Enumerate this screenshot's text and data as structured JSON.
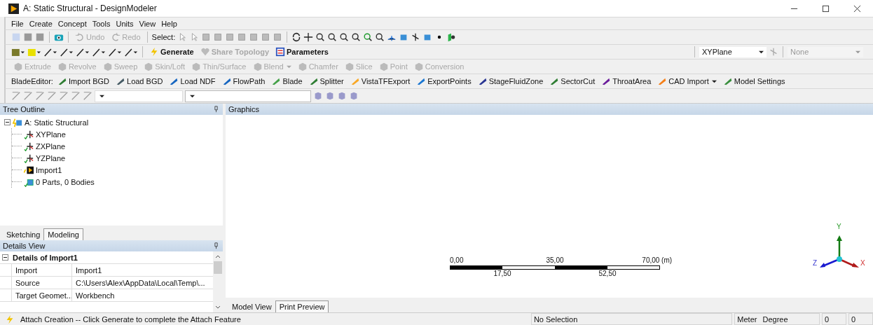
{
  "window": {
    "title": "A: Static Structural - DesignModeler"
  },
  "menu": [
    "File",
    "Create",
    "Concept",
    "Tools",
    "Units",
    "View",
    "Help"
  ],
  "toolbar_main": {
    "undo": {
      "label": "Undo",
      "disabled": true
    },
    "redo": {
      "label": "Redo",
      "disabled": true
    },
    "select_label": "Select:"
  },
  "toolbar_features": {
    "buttons": [
      {
        "label": "Generate",
        "disabled": false,
        "kind": "generate"
      },
      {
        "label": "Share Topology",
        "disabled": true,
        "kind": "share"
      },
      {
        "label": "Parameters",
        "disabled": false,
        "kind": "parameters"
      }
    ],
    "plane": {
      "value": "XYPlane"
    },
    "sketch": {
      "value": "None",
      "disabled": true
    }
  },
  "toolbar_modeling": [
    {
      "label": "Extrude",
      "disabled": true,
      "dropdown": false
    },
    {
      "label": "Revolve",
      "disabled": true,
      "dropdown": false
    },
    {
      "label": "Sweep",
      "disabled": true,
      "dropdown": false
    },
    {
      "label": "Skin/Loft",
      "disabled": true,
      "dropdown": false
    },
    {
      "label": "Thin/Surface",
      "disabled": true,
      "dropdown": false
    },
    {
      "label": "Blend",
      "disabled": true,
      "dropdown": true
    },
    {
      "label": "Chamfer",
      "disabled": true,
      "dropdown": false
    },
    {
      "label": "Slice",
      "disabled": true,
      "dropdown": false
    },
    {
      "label": "Point",
      "disabled": true,
      "dropdown": false
    },
    {
      "label": "Conversion",
      "disabled": true,
      "dropdown": false
    }
  ],
  "blade_editor": {
    "label": "BladeEditor:",
    "buttons": [
      {
        "label": "Import BGD",
        "dropdown": false,
        "color": "#2e7d32"
      },
      {
        "label": "Load BGD",
        "dropdown": false,
        "color": "#455a64"
      },
      {
        "label": "Load NDF",
        "dropdown": false,
        "color": "#1565c0"
      },
      {
        "label": "FlowPath",
        "dropdown": false,
        "color": "#1565c0"
      },
      {
        "label": "Blade",
        "dropdown": false,
        "color": "#43a047"
      },
      {
        "label": "Splitter",
        "dropdown": false,
        "color": "#2e7d32"
      },
      {
        "label": "VistaTFExport",
        "dropdown": false,
        "color": "#f9a825"
      },
      {
        "label": "ExportPoints",
        "dropdown": false,
        "color": "#1976d2"
      },
      {
        "label": "StageFluidZone",
        "dropdown": false,
        "color": "#283593"
      },
      {
        "label": "SectorCut",
        "dropdown": false,
        "color": "#2e7d32"
      },
      {
        "label": "ThroatArea",
        "dropdown": false,
        "color": "#6a1b9a"
      },
      {
        "label": "CAD Import",
        "dropdown": true,
        "color": "#f57f17"
      },
      {
        "label": "Model Settings",
        "dropdown": false,
        "color": "#388e3c"
      }
    ]
  },
  "tree_outline": {
    "title": "Tree Outline",
    "root": {
      "label": "A: Static Structural",
      "kind": "model",
      "expanded": true,
      "children": [
        {
          "label": "XYPlane",
          "kind": "plane"
        },
        {
          "label": "ZXPlane",
          "kind": "plane"
        },
        {
          "label": "YZPlane",
          "kind": "plane"
        },
        {
          "label": "Import1",
          "kind": "import"
        },
        {
          "label": "0 Parts, 0 Bodies",
          "kind": "body"
        }
      ]
    }
  },
  "left_tabs": [
    {
      "label": "Sketching",
      "selected": false
    },
    {
      "label": "Modeling",
      "selected": true
    }
  ],
  "details_view": {
    "title": "Details View",
    "section": {
      "label": "Details of Import1",
      "expanded": true
    },
    "rows": [
      {
        "name": "Import",
        "value": "Import1"
      },
      {
        "name": "Source",
        "value": "C:\\Users\\Alex\\AppData\\Local\\Temp\\..."
      },
      {
        "name": "Target Geomet...",
        "value": "Workbench"
      }
    ]
  },
  "graphics": {
    "title": "Graphics",
    "scale_bar": {
      "top_labels": [
        "0,00",
        "35,00",
        "70,00 (m)"
      ],
      "bottom_labels": [
        "17,50",
        "52,50"
      ]
    },
    "triad": {
      "labels": [
        "Y",
        "Z",
        "X"
      ]
    }
  },
  "view_tabs": [
    {
      "label": "Model View",
      "selected": false
    },
    {
      "label": "Print Preview",
      "selected": true
    }
  ],
  "status_bar": {
    "message": "Attach Creation -- Click Generate to complete the Attach Feature",
    "selection": "No Selection",
    "units": [
      "Meter",
      "Degree"
    ],
    "fields": [
      "0",
      "0"
    ]
  }
}
